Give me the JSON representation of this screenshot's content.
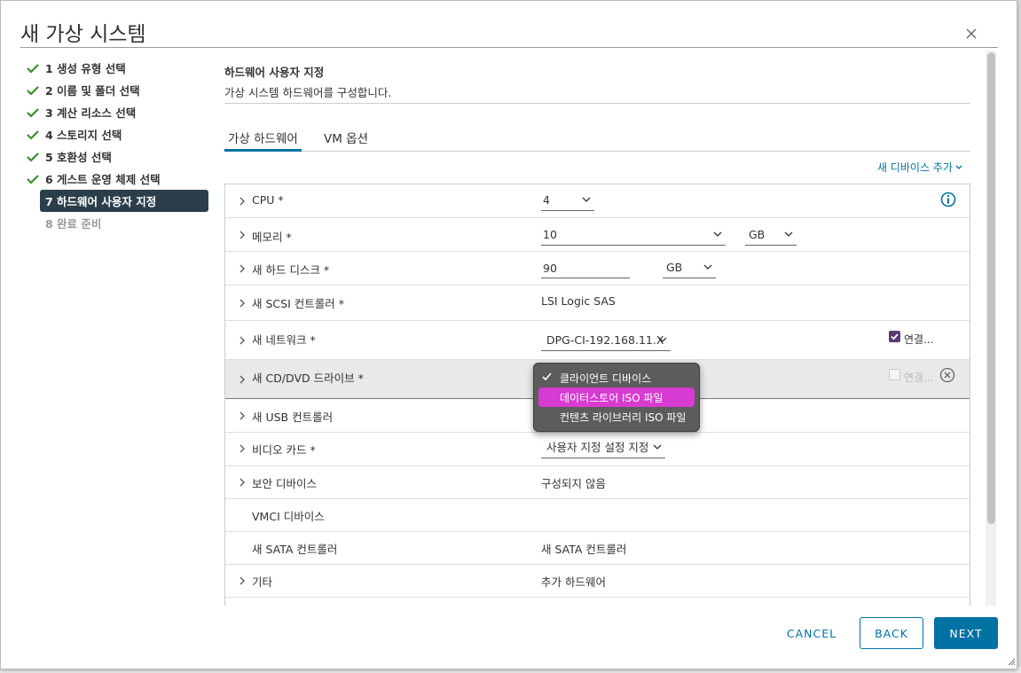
{
  "dialog": {
    "title": "새 가상 시스템"
  },
  "steps": [
    {
      "label": "1 생성 유형 선택",
      "state": "done"
    },
    {
      "label": "2 이름 및 폴더 선택",
      "state": "done"
    },
    {
      "label": "3 계산 리소스 선택",
      "state": "done"
    },
    {
      "label": "4 스토리지 선택",
      "state": "done"
    },
    {
      "label": "5 호환성 선택",
      "state": "done"
    },
    {
      "label": "6 게스트 운영 체제 선택",
      "state": "done"
    },
    {
      "label": "7 하드웨어 사용자 지정",
      "state": "active"
    },
    {
      "label": "8 완료 준비",
      "state": "disabled"
    }
  ],
  "content": {
    "title": "하드웨어 사용자 지정",
    "subtitle": "가상 시스템 하드웨어를 구성합니다."
  },
  "tabs": [
    {
      "label": "가상 하드웨어",
      "selected": true
    },
    {
      "label": "VM 옵션",
      "selected": false
    }
  ],
  "add_device_label": "새 디바이스 추가",
  "hardware": {
    "cpu": {
      "label": "CPU *",
      "value": "4"
    },
    "memory": {
      "label": "메모리 *",
      "value": "10",
      "unit": "GB"
    },
    "disk": {
      "label": "새 하드 디스크 *",
      "value": "90",
      "unit": "GB"
    },
    "scsi": {
      "label": "새 SCSI 컨트롤러 *",
      "value": "LSI Logic SAS"
    },
    "network": {
      "label": "새 네트워크 *",
      "value": "DPG-CI-192.168.11.X",
      "connect_label": "연결..."
    },
    "cddvd": {
      "label": "새 CD/DVD 드라이브 *",
      "connect_label": "연결..."
    },
    "usb": {
      "label": "새 USB 컨트롤러"
    },
    "video": {
      "label": "비디오 카드 *",
      "value": "사용자 지정 설정 지정"
    },
    "security": {
      "label": "보안 디바이스",
      "value": "구성되지 않음"
    },
    "vmci": {
      "label": "VMCI 디바이스"
    },
    "sata": {
      "label": "새 SATA 컨트롤러",
      "value": "새 SATA 컨트롤러"
    },
    "other": {
      "label": "기타",
      "value": "추가 하드웨어"
    }
  },
  "cd_dropdown": {
    "options": [
      "클라이언트 디바이스",
      "데이터스토어 ISO 파일",
      "컨텐츠 라이브러리 ISO 파일"
    ],
    "selected": "클라이언트 디바이스",
    "hovered": "데이터스토어 ISO 파일"
  },
  "buttons": {
    "cancel": "CANCEL",
    "back": "BACK",
    "next": "NEXT"
  },
  "colors": {
    "accent": "#0072a3",
    "active_step": "#2b3f4b",
    "done_check": "#3c8d2f",
    "hover_item": "#d83bd2",
    "checkbox": "#5d3b6f"
  }
}
